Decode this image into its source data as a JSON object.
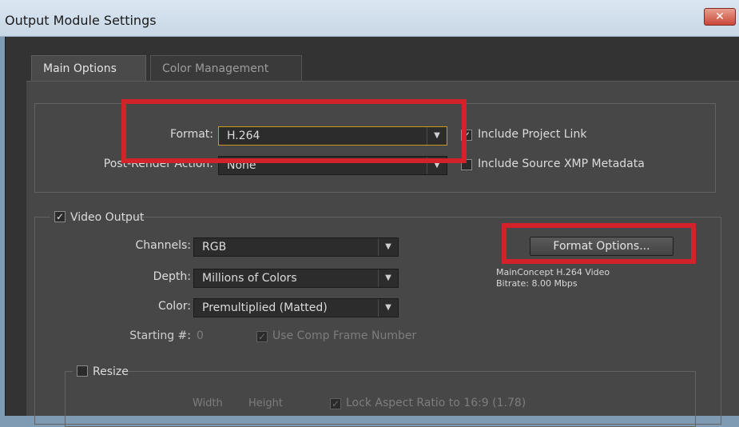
{
  "window": {
    "title": "Output Module Settings",
    "close_glyph": "✕"
  },
  "tabs": [
    {
      "label": "Main Options"
    },
    {
      "label": "Color Management"
    }
  ],
  "format_group": {
    "format_label": "Format:",
    "format_value": "H.264",
    "post_render_label": "Post-Render Action:",
    "post_render_value": "None",
    "include_project_link": {
      "label": "Include Project Link",
      "checked": true
    },
    "include_xmp": {
      "label": "Include Source XMP Metadata",
      "checked": false
    }
  },
  "video_output": {
    "label": "Video Output",
    "checked": true,
    "channels_label": "Channels:",
    "channels_value": "RGB",
    "depth_label": "Depth:",
    "depth_value": "Millions of Colors",
    "color_label": "Color:",
    "color_value": "Premultiplied (Matted)",
    "starting_label": "Starting #:",
    "starting_value": "0",
    "use_comp_frame": {
      "label": "Use Comp Frame Number",
      "checked": true
    },
    "format_options_button": "Format Options...",
    "codec_info_line1": "MainConcept H.264 Video",
    "codec_info_line2": "Bitrate: 8.00 Mbps"
  },
  "resize": {
    "label": "Resize",
    "checked": false,
    "width_label": "Width",
    "height_label": "Height",
    "lock_aspect": {
      "label": "Lock Aspect Ratio to 16:9 (1.78)",
      "checked": true
    }
  },
  "icons": {
    "checkmark": "✓",
    "dropdown_arrow": "▼"
  },
  "colors": {
    "highlight_box": "#d4222a",
    "active_field_border": "#c89b18"
  }
}
